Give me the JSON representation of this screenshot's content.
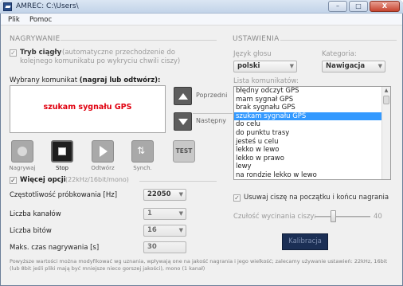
{
  "window": {
    "title": "AMREC: C:\\Users\\",
    "controls": {
      "minimize": "–",
      "maximize": "□",
      "close": "X"
    }
  },
  "menu": [
    "Plik",
    "Pomoc"
  ],
  "left": {
    "section_title": "NAGRYWANIE",
    "continuous": {
      "label": "Tryb ciągły",
      "description_line1": "(automatyczne przechodzenie do",
      "description_line2": "kolejnego komunikatu po wykryciu chwili ciszy)",
      "checked": true
    },
    "selected_label": "Wybrany komunikat",
    "selected_hint": "(nagraj lub odtwórz):",
    "selected_message": "szukam sygnału GPS",
    "message_color": "#e0000f",
    "nav": {
      "prev": "Poprzedni",
      "next": "Następny"
    },
    "controls": [
      {
        "label": "Nagrywaj",
        "icon": "record-icon"
      },
      {
        "label": "Stop",
        "icon": "stop-icon",
        "active": true
      },
      {
        "label": "Odtwórz",
        "icon": "play-icon"
      },
      {
        "label": "Synch.",
        "icon": "sync-icon"
      }
    ],
    "test_label": "TEST",
    "more_options": {
      "label": "Więcej opcji",
      "hint": "(22kHz/16bit/mono)"
    },
    "fields": [
      {
        "label": "Częstotliwość próbkowania [Hz]",
        "value": "22050"
      },
      {
        "label": "Liczba kanałów",
        "value": "1"
      },
      {
        "label": "Liczba bitów",
        "value": "16"
      },
      {
        "label": "Maks. czas nagrywania [s]",
        "value": "30"
      }
    ],
    "footnote": "Powyższe wartości można modyfikować wg uznania, wpływają one na jakość nagrania i jego wielkość; zalecamy używanie ustawień: 22kHz, 16bit (lub 8bit jeśli pliki mają być mniejsze nieco gorszej jakości), mono (1 kanał)"
  },
  "right": {
    "section_title": "USTAWIENIA",
    "language": {
      "label": "Język głosu",
      "value": "polski"
    },
    "category": {
      "label": "Kategoria:",
      "value": "Nawigacja"
    },
    "list_label": "Lista komunikatów:",
    "messages": [
      "błędny odczyt GPS",
      "mam sygnał GPS",
      "brak sygnału GPS",
      "szukam sygnału GPS",
      "do celu",
      "do punktu trasy",
      "jesteś u celu",
      "lekko w lewo",
      "lekko w prawo",
      "lewy",
      "na rondzie lekko w lewo"
    ],
    "selected_index": 3,
    "trim": {
      "label": "Usuwaj ciszę na początku i końcu nagrania",
      "checked": true
    },
    "sensitivity": {
      "label": "Czułość wycinania ciszy:",
      "value": 40,
      "max": 100,
      "fraction": 0.33
    },
    "calibrate_label": "Kalibracja"
  }
}
